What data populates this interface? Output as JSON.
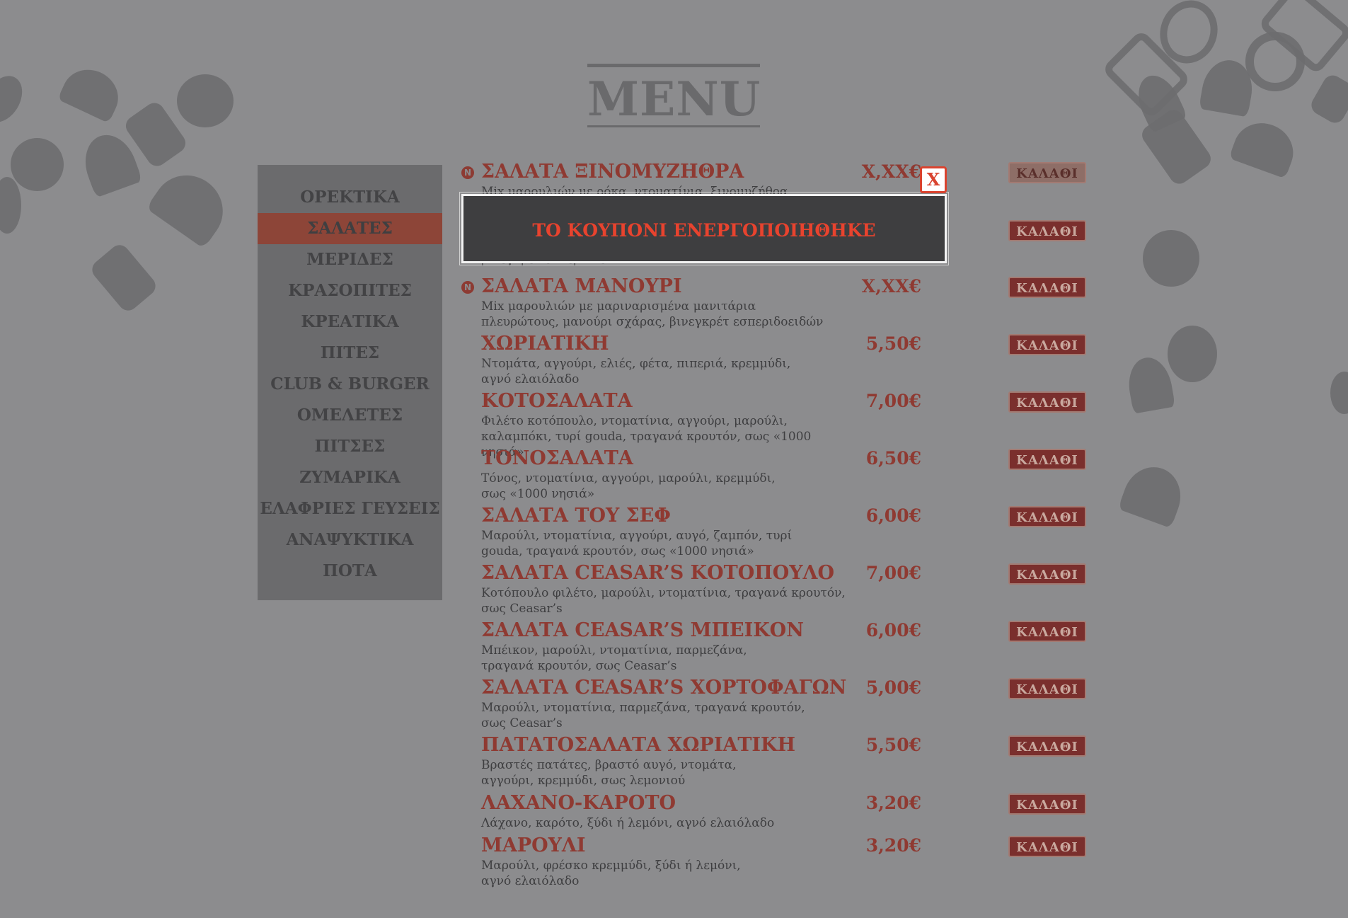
{
  "header": {
    "title": "MENU"
  },
  "colors": {
    "accent": "#8f3a32",
    "background": "#8c8c8e",
    "sidebar": "#6b6b6d",
    "alert": "#e8432e"
  },
  "sidebar": {
    "items": [
      {
        "label": "ΟΡΕΚΤΙΚΑ",
        "active": false
      },
      {
        "label": "ΣΑΛΑΤΕΣ",
        "active": true
      },
      {
        "label": "ΜΕΡΙΔΕΣ",
        "active": false
      },
      {
        "label": "ΚΡΑΣΟΠΙΤΕΣ",
        "active": false
      },
      {
        "label": "ΚΡΕΑΤΙΚΑ",
        "active": false
      },
      {
        "label": "ΠΙΤΕΣ",
        "active": false
      },
      {
        "label": "CLUB & BURGER",
        "active": false
      },
      {
        "label": "ΟΜΕΛΕΤΕΣ",
        "active": false
      },
      {
        "label": "ΠΙΤΣΕΣ",
        "active": false
      },
      {
        "label": "ΖΥΜΑΡΙΚΑ",
        "active": false
      },
      {
        "label": "ΕΛΑΦΡΙΕΣ ΓΕΥΣΕΙΣ",
        "active": false
      },
      {
        "label": "ΑΝΑΨΥΚΤΙΚΑ",
        "active": false
      },
      {
        "label": "ΠΟΤΑ",
        "active": false
      }
    ]
  },
  "menu_items": [
    {
      "name": "ΣΑΛΑΤΑ ΞΙΝΟΜΥΖΗΘΡΑ",
      "desc": "Mix μαρουλιών με ρόκα, ντοματίνια, ξινομυζήθρα",
      "price": "X,XX€",
      "veg_icon": "N",
      "cart_label": "ΚΑΛΑΘΙ"
    },
    {
      "name": "",
      "desc": "βινεγκρέτ εσπεριδοειδών",
      "price": "",
      "veg_icon": "",
      "cart_label": "ΚΑΛΑΘΙ"
    },
    {
      "name": "ΣΑΛΑΤΑ ΜΑΝΟΥΡΙ",
      "desc": "Mix μαρουλιών με μαριναρισμένα μανιτάρια πλευρώτους, μανούρι σχάρας, βινεγκρέτ εσπεριδοειδών",
      "price": "X,XX€",
      "veg_icon": "N",
      "cart_label": "ΚΑΛΑΘΙ"
    },
    {
      "name": "ΧΩΡΙΑΤΙΚΗ",
      "desc": "Ντομάτα, αγγούρι, ελιές, φέτα, πιπεριά, κρεμμύδι, αγνό ελαιόλαδο",
      "price": "5,50€",
      "veg_icon": "",
      "cart_label": "ΚΑΛΑΘΙ"
    },
    {
      "name": "ΚΟΤΟΣΑΛΑΤΑ",
      "desc": "Φιλέτο κοτόπουλο, ντοματίνια, αγγούρι, μαρούλι, καλαμπόκι, τυρί gouda, τραγανά κρουτόν, σως «1000 νησιά»",
      "price": "7,00€",
      "veg_icon": "",
      "cart_label": "ΚΑΛΑΘΙ"
    },
    {
      "name": "ΤΟΝΟΣΑΛΑΤΑ",
      "desc": "Τόνος, ντοματίνια, αγγούρι, μαρούλι, κρεμμύδι, σως «1000 νησιά»",
      "price": "6,50€",
      "veg_icon": "",
      "cart_label": "ΚΑΛΑΘΙ"
    },
    {
      "name": "ΣΑΛΑΤΑ ΤΟΥ ΣΕΦ",
      "desc": "Μαρούλι, ντοματίνια, αγγούρι, αυγό, ζαμπόν, τυρί gouda, τραγανά κρουτόν, σως «1000 νησιά»",
      "price": "6,00€",
      "veg_icon": "",
      "cart_label": "ΚΑΛΑΘΙ"
    },
    {
      "name": "ΣΑΛΑΤΑ CEASAR’S ΚΟΤΟΠΟΥΛΟ",
      "desc": "Κοτόπουλο φιλέτο, μαρούλι, ντοματίνια, τραγανά κρουτόν, σως Ceasar’s",
      "price": "7,00€",
      "veg_icon": "",
      "cart_label": "ΚΑΛΑΘΙ"
    },
    {
      "name": "ΣΑΛΑΤΑ CEASAR’S ΜΠΕΙΚΟΝ",
      "desc": "Μπέικον, μαρούλι, ντοματίνια, παρμεζάνα, τραγανά κρουτόν, σως Ceasar’s",
      "price": "6,00€",
      "veg_icon": "",
      "cart_label": "ΚΑΛΑΘΙ"
    },
    {
      "name": "ΣΑΛΑΤΑ CEASAR’S ΧΟΡΤΟΦΑΓΩΝ",
      "desc": "Μαρούλι, ντοματίνια, παρμεζάνα, τραγανά κρουτόν, σως Ceasar’s",
      "price": "5,00€",
      "veg_icon": "",
      "cart_label": "ΚΑΛΑΘΙ"
    },
    {
      "name": "ΠΑΤΑΤΟΣΑΛΑΤΑ ΧΩΡΙΑΤΙΚΗ",
      "desc": "Βραστές πατάτες, βραστό αυγό, ντομάτα, αγγούρι, κρεμμύδι, σως λεμονιού",
      "price": "5,50€",
      "veg_icon": "",
      "cart_label": "ΚΑΛΑΘΙ"
    },
    {
      "name": "ΛΑΧΑΝΟ-ΚΑΡΟΤΟ",
      "desc": "Λάχανο, καρότο, ξύδι ή λεμόνι, αγνό ελαιόλαδο",
      "price": "3,20€",
      "veg_icon": "",
      "cart_label": "ΚΑΛΑΘΙ"
    },
    {
      "name": "ΜΑΡΟΥΛΙ",
      "desc": "Μαρούλι, φρέσκο κρεμμύδι, ξύδι ή λεμόνι, αγνό ελαιόλαδο",
      "price": "3,20€",
      "veg_icon": "",
      "cart_label": "ΚΑΛΑΘΙ"
    }
  ],
  "modal": {
    "message": "ΤΟ ΚΟΥΠΟΝΙ ΕΝΕΡΓΟΠΟΙΗΘΗΚΕ",
    "close_label": "X"
  }
}
